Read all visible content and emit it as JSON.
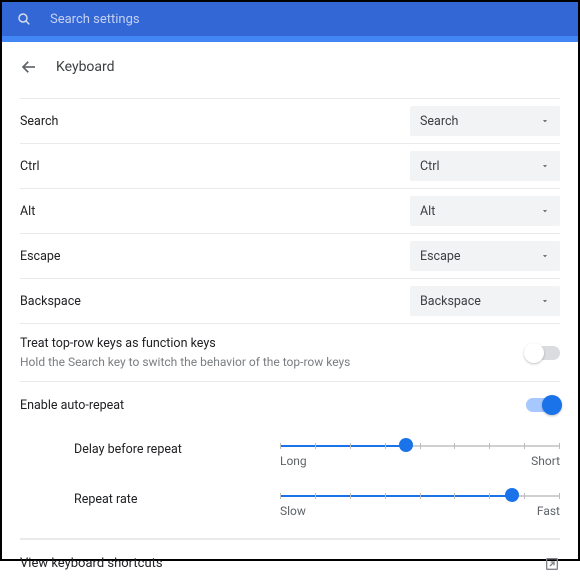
{
  "search": {
    "placeholder": "Search settings",
    "value": ""
  },
  "page": {
    "title": "Keyboard"
  },
  "keymap": [
    {
      "label": "Search",
      "value": "Search"
    },
    {
      "label": "Ctrl",
      "value": "Ctrl"
    },
    {
      "label": "Alt",
      "value": "Alt"
    },
    {
      "label": "Escape",
      "value": "Escape"
    },
    {
      "label": "Backspace",
      "value": "Backspace"
    }
  ],
  "toprow": {
    "label": "Treat top-row keys as function keys",
    "sublabel": "Hold the Search key to switch the behavior of the top-row keys",
    "enabled": false
  },
  "autoRepeat": {
    "label": "Enable auto-repeat",
    "enabled": true,
    "delay": {
      "label": "Delay before repeat",
      "leftLabel": "Long",
      "rightLabel": "Short",
      "percent": 45
    },
    "rate": {
      "label": "Repeat rate",
      "leftLabel": "Slow",
      "rightLabel": "Fast",
      "percent": 83
    }
  },
  "footer": {
    "label": "View keyboard shortcuts"
  }
}
